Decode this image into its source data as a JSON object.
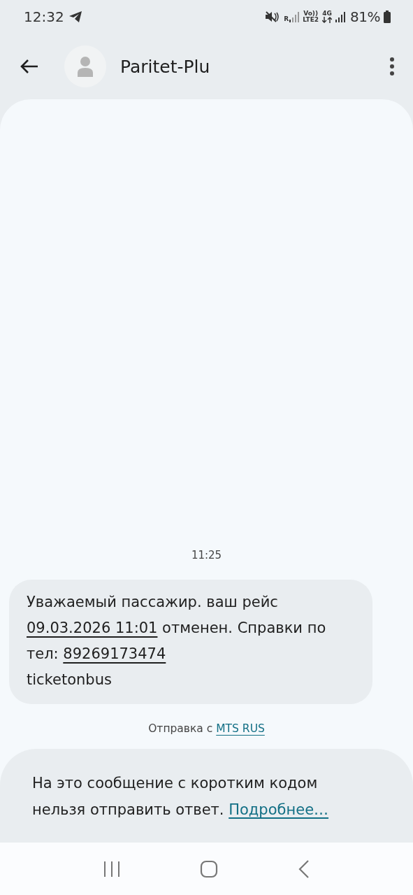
{
  "status_bar": {
    "time": "12:32",
    "roaming": "R",
    "volte": "Vo))",
    "lte": "LTE2",
    "network": "4G",
    "battery": "81%"
  },
  "header": {
    "contact": "Paritet-Plu"
  },
  "conversation": {
    "timestamp": "11:25",
    "message": {
      "parts": [
        {
          "kind": "text",
          "text": "Уважаемый пассажир. ваш рейс "
        },
        {
          "kind": "link",
          "text": "09.03.2026 11:01"
        },
        {
          "kind": "text",
          "text": " отменен. Справки по тел: "
        },
        {
          "kind": "link",
          "text": "89269173474"
        },
        {
          "kind": "break"
        },
        {
          "kind": "text",
          "text": "ticketonbus"
        }
      ]
    },
    "sent_via": {
      "label": "Отправка с ",
      "carrier": "MTS RUS"
    }
  },
  "notice": {
    "text": "На это сообщение с коротким кодом нельзя отправить ответ. ",
    "link": "Подробнее…"
  }
}
